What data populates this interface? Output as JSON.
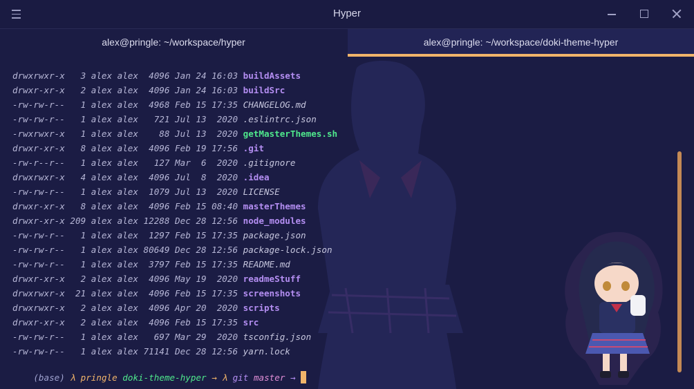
{
  "window": {
    "title": "Hyper"
  },
  "tabs": [
    {
      "label": "alex@pringle: ~/workspace/hyper",
      "active": false
    },
    {
      "label": "alex@pringle: ~/workspace/doki-theme-hyper",
      "active": true
    }
  ],
  "listing": [
    {
      "perms": "drwxrwxr-x",
      "links": "3",
      "owner": "alex",
      "group": "alex",
      "size": "4096",
      "month": "Jan",
      "day": "24",
      "time": "16:03",
      "name": "buildAssets",
      "kind": "dir"
    },
    {
      "perms": "drwxr-xr-x",
      "links": "2",
      "owner": "alex",
      "group": "alex",
      "size": "4096",
      "month": "Jan",
      "day": "24",
      "time": "16:03",
      "name": "buildSrc",
      "kind": "dir"
    },
    {
      "perms": "-rw-rw-r--",
      "links": "1",
      "owner": "alex",
      "group": "alex",
      "size": "4968",
      "month": "Feb",
      "day": "15",
      "time": "17:35",
      "name": "CHANGELOG.md",
      "kind": "file"
    },
    {
      "perms": "-rw-rw-r--",
      "links": "1",
      "owner": "alex",
      "group": "alex",
      "size": "721",
      "month": "Jul",
      "day": "13",
      "time": " 2020",
      "name": ".eslintrc.json",
      "kind": "file"
    },
    {
      "perms": "-rwxrwxr-x",
      "links": "1",
      "owner": "alex",
      "group": "alex",
      "size": "88",
      "month": "Jul",
      "day": "13",
      "time": " 2020",
      "name": "getMasterThemes.sh",
      "kind": "exec"
    },
    {
      "perms": "drwxr-xr-x",
      "links": "8",
      "owner": "alex",
      "group": "alex",
      "size": "4096",
      "month": "Feb",
      "day": "19",
      "time": "17:56",
      "name": ".git",
      "kind": "dir"
    },
    {
      "perms": "-rw-r--r--",
      "links": "1",
      "owner": "alex",
      "group": "alex",
      "size": "127",
      "month": "Mar",
      "day": " 6",
      "time": " 2020",
      "name": ".gitignore",
      "kind": "file"
    },
    {
      "perms": "drwxrwxr-x",
      "links": "4",
      "owner": "alex",
      "group": "alex",
      "size": "4096",
      "month": "Jul",
      "day": " 8",
      "time": " 2020",
      "name": ".idea",
      "kind": "dir"
    },
    {
      "perms": "-rw-rw-r--",
      "links": "1",
      "owner": "alex",
      "group": "alex",
      "size": "1079",
      "month": "Jul",
      "day": "13",
      "time": " 2020",
      "name": "LICENSE",
      "kind": "file"
    },
    {
      "perms": "drwxr-xr-x",
      "links": "8",
      "owner": "alex",
      "group": "alex",
      "size": "4096",
      "month": "Feb",
      "day": "15",
      "time": "08:40",
      "name": "masterThemes",
      "kind": "dir"
    },
    {
      "perms": "drwxr-xr-x",
      "links": "209",
      "owner": "alex",
      "group": "alex",
      "size": "12288",
      "month": "Dec",
      "day": "28",
      "time": "12:56",
      "name": "node_modules",
      "kind": "dir"
    },
    {
      "perms": "-rw-rw-r--",
      "links": "1",
      "owner": "alex",
      "group": "alex",
      "size": "1297",
      "month": "Feb",
      "day": "15",
      "time": "17:35",
      "name": "package.json",
      "kind": "file"
    },
    {
      "perms": "-rw-rw-r--",
      "links": "1",
      "owner": "alex",
      "group": "alex",
      "size": "80649",
      "month": "Dec",
      "day": "28",
      "time": "12:56",
      "name": "package-lock.json",
      "kind": "file"
    },
    {
      "perms": "-rw-rw-r--",
      "links": "1",
      "owner": "alex",
      "group": "alex",
      "size": "3797",
      "month": "Feb",
      "day": "15",
      "time": "17:35",
      "name": "README.md",
      "kind": "file"
    },
    {
      "perms": "drwxr-xr-x",
      "links": "2",
      "owner": "alex",
      "group": "alex",
      "size": "4096",
      "month": "May",
      "day": "19",
      "time": " 2020",
      "name": "readmeStuff",
      "kind": "dir"
    },
    {
      "perms": "drwxrwxr-x",
      "links": "21",
      "owner": "alex",
      "group": "alex",
      "size": "4096",
      "month": "Feb",
      "day": "15",
      "time": "17:35",
      "name": "screenshots",
      "kind": "dir"
    },
    {
      "perms": "drwxrwxr-x",
      "links": "2",
      "owner": "alex",
      "group": "alex",
      "size": "4096",
      "month": "Apr",
      "day": "20",
      "time": " 2020",
      "name": "scripts",
      "kind": "dir"
    },
    {
      "perms": "drwxr-xr-x",
      "links": "2",
      "owner": "alex",
      "group": "alex",
      "size": "4096",
      "month": "Feb",
      "day": "15",
      "time": "17:35",
      "name": "src",
      "kind": "dir"
    },
    {
      "perms": "-rw-rw-r--",
      "links": "1",
      "owner": "alex",
      "group": "alex",
      "size": "697",
      "month": "Mar",
      "day": "29",
      "time": " 2020",
      "name": "tsconfig.json",
      "kind": "file"
    },
    {
      "perms": "-rw-rw-r--",
      "links": "1",
      "owner": "alex",
      "group": "alex",
      "size": "71141",
      "month": "Dec",
      "day": "28",
      "time": "12:56",
      "name": "yarn.lock",
      "kind": "file"
    }
  ],
  "prompt": {
    "env": "(base)",
    "lambda": "λ",
    "host": "pringle",
    "dir": "doki-theme-hyper",
    "arrow": "→",
    "lambda2": "λ",
    "git": "git",
    "branch": "master",
    "arrow2": "→"
  },
  "colors": {
    "background": "#1b1c44",
    "accent": "#f1b46a",
    "directory": "#b48ef2",
    "executable": "#4fe88c"
  }
}
